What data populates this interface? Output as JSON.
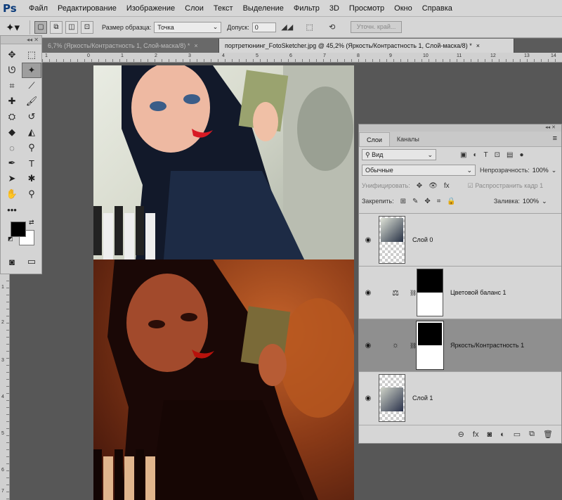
{
  "app": {
    "logo": "Ps"
  },
  "menu": [
    "Файл",
    "Редактирование",
    "Изображение",
    "Слои",
    "Текст",
    "Выделение",
    "Фильтр",
    "3D",
    "Просмотр",
    "Окно",
    "Справка"
  ],
  "options": {
    "tool_icon": "magic-wand-icon",
    "sample_size_label": "Размер образца:",
    "sample_size_value": "Точка",
    "tolerance_label": "Допуск:",
    "tolerance_value": "0",
    "refine_edge_button": "Уточн. край..."
  },
  "tabs": [
    {
      "label": "6,7% (Яркость/Контрастность 1, Слой-маска/8) *",
      "close": "×",
      "active": false
    },
    {
      "label": "портретюнинг_FotoSketcher.jpg @ 45,2% (Яркость/Контрастность 1, Слой-маска/8) *",
      "close": "×",
      "active": true
    }
  ],
  "rulers": {
    "top": [
      "1",
      "0",
      "1",
      "2",
      "3",
      "4",
      "5",
      "6",
      "7",
      "8",
      "9",
      "10",
      "11",
      "12",
      "13",
      "14"
    ],
    "left": [
      "1",
      "2",
      "3",
      "4",
      "5",
      "6",
      "7"
    ]
  },
  "tools": {
    "icons": [
      "move-icon",
      "marquee-icon",
      "lasso-icon",
      "magic-wand-icon",
      "crop-icon",
      "eyedropper-icon",
      "healing-icon",
      "brush-icon",
      "stamp-icon",
      "history-brush-icon",
      "eraser-icon",
      "bucket-icon",
      "blur-icon",
      "dodge-icon",
      "pen-icon",
      "type-icon",
      "path-select-icon",
      "shape-icon",
      "hand-icon",
      "zoom-icon",
      "more-icon"
    ],
    "fg_color": "#000000",
    "bg_color": "#ffffff"
  },
  "layers_panel": {
    "tabs": [
      "Слои",
      "Каналы"
    ],
    "filter_label": "Вид",
    "blend_mode": "Обычные",
    "opacity_label": "Непрозрачность:",
    "opacity_value": "100%",
    "unify_label": "Унифицировать:",
    "propagate_label": "Распространить кадр 1",
    "lock_label": "Закрепить:",
    "fill_label": "Заливка:",
    "fill_value": "100%",
    "layers": [
      {
        "name": "Слой 0",
        "kind": "pixel",
        "selected": false
      },
      {
        "name": "Цветовой баланс 1",
        "kind": "adjustment",
        "icon": "balance-icon",
        "selected": false
      },
      {
        "name": "Яркость/Контрастность 1",
        "kind": "adjustment",
        "icon": "brightness-icon",
        "selected": true
      },
      {
        "name": "Слой 1",
        "kind": "pixel",
        "selected": false
      }
    ]
  },
  "colors": {
    "selected_layer": "#8f8f8f",
    "panel_bg": "#d6d6d6",
    "canvas_bg": "#575757"
  }
}
